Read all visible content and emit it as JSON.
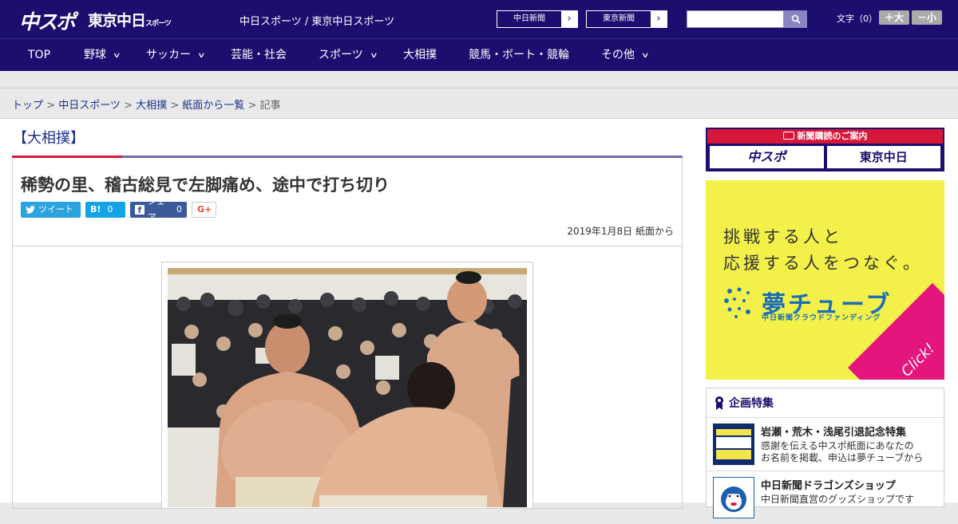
{
  "header": {
    "logo_main": "中スポ",
    "logo_tokyo": "東京中日",
    "logo_tokyo_small": "スポーツ",
    "site_name": "中日スポーツ / 東京中日スポーツ",
    "paper_buttons": [
      {
        "label": "中日新聞",
        "arrow": "›"
      },
      {
        "label": "東京新聞",
        "arrow": "›"
      }
    ],
    "search_placeholder": "",
    "font_size_label": "文字（0）",
    "font_larger": "＋大",
    "font_smaller": "－小"
  },
  "nav": {
    "items": [
      {
        "label": "TOP",
        "has_menu": false
      },
      {
        "label": "野球",
        "has_menu": true
      },
      {
        "label": "サッカー",
        "has_menu": true
      },
      {
        "label": "芸能・社会",
        "has_menu": false
      },
      {
        "label": "スポーツ",
        "has_menu": true
      },
      {
        "label": "大相撲",
        "has_menu": false
      },
      {
        "label": "競馬・ボート・競輪",
        "has_menu": false
      },
      {
        "label": "その他",
        "has_menu": true
      }
    ],
    "chevron": "∨"
  },
  "breadcrumb": {
    "items": [
      "トップ",
      "中日スポーツ",
      "大相撲",
      "紙面から一覧"
    ],
    "separator": " > ",
    "current": "記事"
  },
  "article": {
    "category": "【大相撲】",
    "title": "稀勢の里、稽古総見で左脚痛め、途中で打ち切り",
    "share": {
      "tweet": "ツイート",
      "hatena_label": "B!",
      "hatena_count": "0",
      "facebook_label": "シェア",
      "facebook_count": "0",
      "gplus": "G+"
    },
    "date": "2019年1月8日 紙面から"
  },
  "sidebar": {
    "subscription_title": "新聞購読のご案内",
    "subscription_logos": [
      "中スポ",
      "東京中日"
    ],
    "ad": {
      "line1": "挑戦する人と",
      "line2": "応援する人をつなぐ。",
      "brand": "夢チューブ",
      "brand_sub": "中日新聞クラウドファンディング",
      "click": "Click!"
    },
    "features_title": "企画特集",
    "features": [
      {
        "title": "岩瀬・荒木・浅尾引退記念特集",
        "desc1": "感謝を伝える中スポ紙面にあなたの",
        "desc2": "お名前を掲載、申込は夢チューブから"
      },
      {
        "title": "中日新聞ドラゴンズショップ",
        "desc1": "中日新聞直営のグッズショップです",
        "desc2": ""
      }
    ]
  },
  "colors": {
    "brand_navy": "#1b0e6e",
    "accent_red": "#d6173a",
    "link_blue": "#1b2f8a",
    "ad_yellow": "#f3f04a",
    "ad_pink": "#e4157d"
  }
}
